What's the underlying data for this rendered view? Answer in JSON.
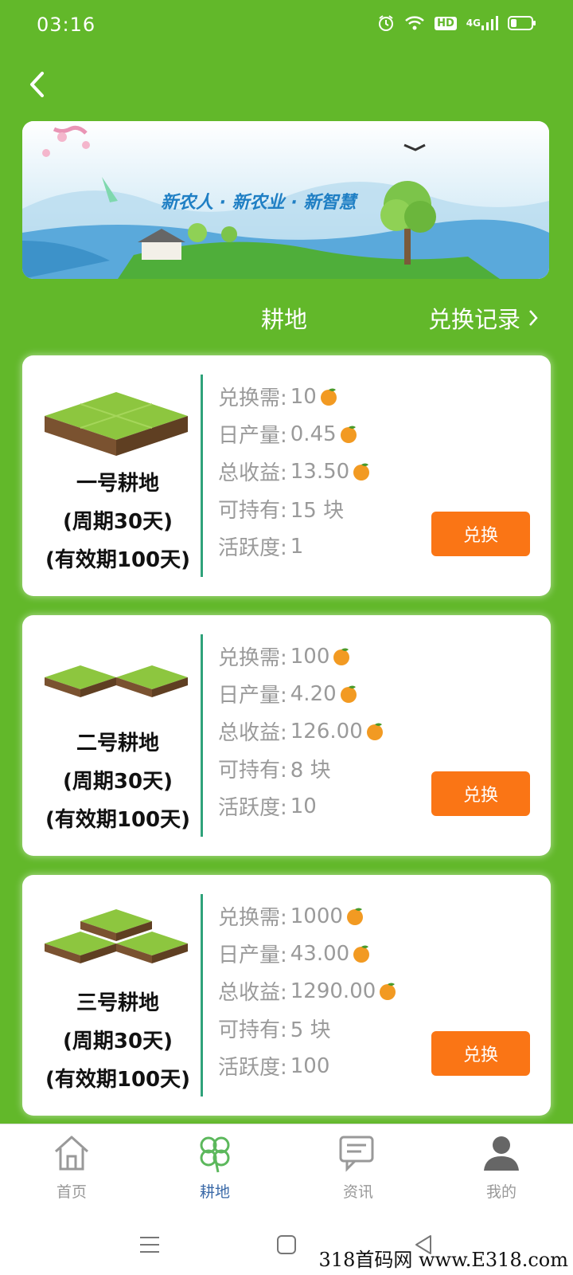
{
  "status_bar": {
    "time": "03:16",
    "icons": [
      "alarm-icon",
      "wifi-icon",
      "hd-icon",
      "signal-4g-icon",
      "battery-icon"
    ],
    "hd_label": "HD",
    "network_label": "4G"
  },
  "header": {
    "back_icon": "chevron-left-icon"
  },
  "banner": {
    "slogan": "新农人 · 新农业 · 新智慧"
  },
  "tabs": {
    "farmland": "耕地",
    "records": "兑换记录"
  },
  "cards": [
    {
      "name": "一号耕地",
      "period": "(周期30天)",
      "validity": "(有效期100天)",
      "cost_label": "兑换需:",
      "cost": "10",
      "daily_label": "日产量:",
      "daily": "0.45",
      "total_label": "总收益:",
      "total": "13.50",
      "hold_label": "可持有:",
      "hold": "15 块",
      "activity_label": "活跃度:",
      "activity": "1",
      "button": "兑换"
    },
    {
      "name": "二号耕地",
      "period": "(周期30天)",
      "validity": "(有效期100天)",
      "cost_label": "兑换需:",
      "cost": "100",
      "daily_label": "日产量:",
      "daily": "4.20",
      "total_label": "总收益:",
      "total": "126.00",
      "hold_label": "可持有:",
      "hold": "8 块",
      "activity_label": "活跃度:",
      "activity": "10",
      "button": "兑换"
    },
    {
      "name": "三号耕地",
      "period": "(周期30天)",
      "validity": "(有效期100天)",
      "cost_label": "兑换需:",
      "cost": "1000",
      "daily_label": "日产量:",
      "daily": "43.00",
      "total_label": "总收益:",
      "total": "1290.00",
      "hold_label": "可持有:",
      "hold": "5 块",
      "activity_label": "活跃度:",
      "activity": "100",
      "button": "兑换"
    }
  ],
  "bottom_nav": {
    "items": [
      {
        "label": "首页",
        "icon": "home-icon"
      },
      {
        "label": "耕地",
        "icon": "clover-icon",
        "active": true
      },
      {
        "label": "资讯",
        "icon": "chat-icon"
      },
      {
        "label": "我的",
        "icon": "user-icon"
      }
    ]
  },
  "watermark": "318首码网 www.E318.com",
  "colors": {
    "background": "#62b82a",
    "button": "#fa7515",
    "divider": "#2fa27a",
    "nav_active": "#3b6aa8"
  }
}
